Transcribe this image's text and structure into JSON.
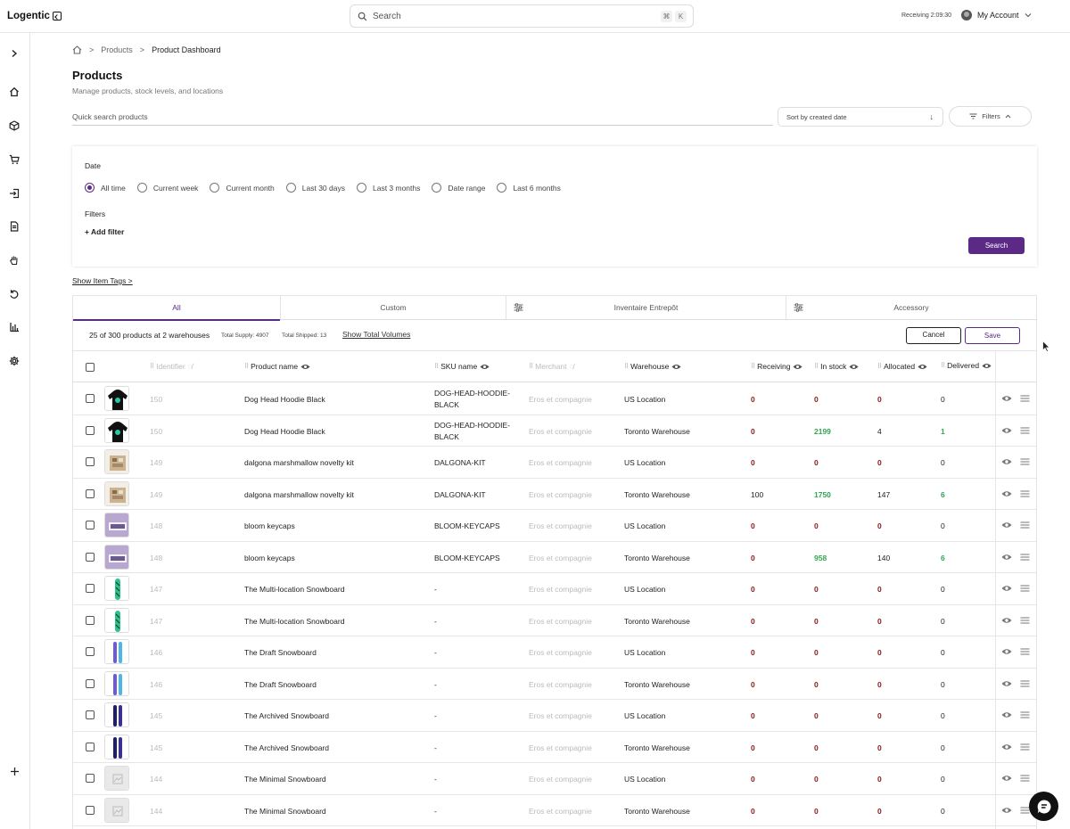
{
  "app": {
    "name": "Logentic"
  },
  "topbar": {
    "search_label": "Search",
    "kbd_cmd": "⌘",
    "kbd_k": "K",
    "receiving_label": "Receiving 2:09:30",
    "account_label": "My Account"
  },
  "breadcrumb": {
    "products": "Products",
    "current": "Product Dashboard"
  },
  "page": {
    "title": "Products",
    "subtitle": "Manage products, stock levels, and locations"
  },
  "controls": {
    "quick_search_placeholder": "Quick search products",
    "sort_label": "Sort by created date",
    "filters_label": "Filters"
  },
  "filter_panel": {
    "date_label": "Date",
    "date_options": [
      "All time",
      "Current week",
      "Current month",
      "Last 30 days",
      "Last 3 months",
      "Date range",
      "Last 6 months"
    ],
    "selected_date": "All time",
    "filters_label": "Filters",
    "add_filter_label": "+ Add filter",
    "search_button": "Search"
  },
  "show_item_tags": "Show Item Tags >",
  "tabs": [
    "All",
    "Custom",
    "Inventaire Entrepôt",
    "Accessory"
  ],
  "summary": {
    "count_text": "25 of 300 products at 2 warehouses",
    "total_supply": "Total Supply: 4907",
    "total_shipped": "Total Shipped: 13",
    "show_volumes": "Show Total Volumes",
    "cancel": "Cancel",
    "save": "Save"
  },
  "columns": {
    "identifier": "Identifier",
    "product_name": "Product name",
    "sku": "SKU name",
    "merchant": "Merchant",
    "warehouse": "Warehouse",
    "receiving": "Receiving",
    "in_stock": "In stock",
    "allocated": "Allocated",
    "delivered": "Delivered"
  },
  "rows": [
    {
      "thumb": "hoodie",
      "id": "150",
      "name": "Dog Head Hoodie Black",
      "sku": "DOG-HEAD-HOODIE-BLACK",
      "merchant": "Eros et compagnie",
      "warehouse": "US Location",
      "receiving": "0",
      "in_stock": "0",
      "allocated": "0",
      "delivered": "0"
    },
    {
      "thumb": "hoodie",
      "id": "150",
      "name": "Dog Head Hoodie Black",
      "sku": "DOG-HEAD-HOODIE-BLACK",
      "merchant": "Eros et compagnie",
      "warehouse": "Toronto Warehouse",
      "receiving": "0",
      "in_stock": "2199",
      "allocated": "4",
      "delivered": "1"
    },
    {
      "thumb": "kit",
      "id": "149",
      "name": "dalgona marshmallow novelty kit",
      "sku": "DALGONA-KIT",
      "merchant": "Eros et compagnie",
      "warehouse": "US Location",
      "receiving": "0",
      "in_stock": "0",
      "allocated": "0",
      "delivered": "0"
    },
    {
      "thumb": "kit",
      "id": "149",
      "name": "dalgona marshmallow novelty kit",
      "sku": "DALGONA-KIT",
      "merchant": "Eros et compagnie",
      "warehouse": "Toronto Warehouse",
      "receiving": "100",
      "in_stock": "1750",
      "allocated": "147",
      "delivered": "6"
    },
    {
      "thumb": "keycaps",
      "id": "148",
      "name": "bloom keycaps",
      "sku": "BLOOM-KEYCAPS",
      "merchant": "Eros et compagnie",
      "warehouse": "US Location",
      "receiving": "0",
      "in_stock": "0",
      "allocated": "0",
      "delivered": "0"
    },
    {
      "thumb": "keycaps",
      "id": "148",
      "name": "bloom keycaps",
      "sku": "BLOOM-KEYCAPS",
      "merchant": "Eros et compagnie",
      "warehouse": "Toronto Warehouse",
      "receiving": "0",
      "in_stock": "958",
      "allocated": "140",
      "delivered": "6"
    },
    {
      "thumb": "board-green",
      "id": "147",
      "name": "The Multi-location Snowboard",
      "sku": "-",
      "merchant": "Eros et compagnie",
      "warehouse": "US Location",
      "receiving": "0",
      "in_stock": "0",
      "allocated": "0",
      "delivered": "0"
    },
    {
      "thumb": "board-green",
      "id": "147",
      "name": "The Multi-location Snowboard",
      "sku": "-",
      "merchant": "Eros et compagnie",
      "warehouse": "Toronto Warehouse",
      "receiving": "0",
      "in_stock": "0",
      "allocated": "0",
      "delivered": "0"
    },
    {
      "thumb": "board-purple",
      "id": "146",
      "name": "The Draft Snowboard",
      "sku": "-",
      "merchant": "Eros et compagnie",
      "warehouse": "US Location",
      "receiving": "0",
      "in_stock": "0",
      "allocated": "0",
      "delivered": "0"
    },
    {
      "thumb": "board-purple",
      "id": "146",
      "name": "The Draft Snowboard",
      "sku": "-",
      "merchant": "Eros et compagnie",
      "warehouse": "Toronto Warehouse",
      "receiving": "0",
      "in_stock": "0",
      "allocated": "0",
      "delivered": "0"
    },
    {
      "thumb": "board-navy",
      "id": "145",
      "name": "The Archived Snowboard",
      "sku": "-",
      "merchant": "Eros et compagnie",
      "warehouse": "US Location",
      "receiving": "0",
      "in_stock": "0",
      "allocated": "0",
      "delivered": "0"
    },
    {
      "thumb": "board-navy",
      "id": "145",
      "name": "The Archived Snowboard",
      "sku": "-",
      "merchant": "Eros et compagnie",
      "warehouse": "Toronto Warehouse",
      "receiving": "0",
      "in_stock": "0",
      "allocated": "0",
      "delivered": "0"
    },
    {
      "thumb": "placeholder",
      "id": "144",
      "name": "The Minimal Snowboard",
      "sku": "-",
      "merchant": "Eros et compagnie",
      "warehouse": "US Location",
      "receiving": "0",
      "in_stock": "0",
      "allocated": "0",
      "delivered": "0"
    },
    {
      "thumb": "placeholder",
      "id": "144",
      "name": "The Minimal Snowboard",
      "sku": "-",
      "merchant": "Eros et compagnie",
      "warehouse": "Toronto Warehouse",
      "receiving": "0",
      "in_stock": "0",
      "allocated": "0",
      "delivered": "0"
    }
  ],
  "colors": {
    "accent": "#5b2a86",
    "positive": "#2fa84f",
    "zero": "#8b1a1a"
  },
  "sidebar_icons": [
    "chevron-right-icon",
    "home-icon",
    "box-icon",
    "cart-icon",
    "inbound-icon",
    "document-icon",
    "hand-icon",
    "returns-icon",
    "chart-icon",
    "gear-icon",
    "plus-icon"
  ]
}
